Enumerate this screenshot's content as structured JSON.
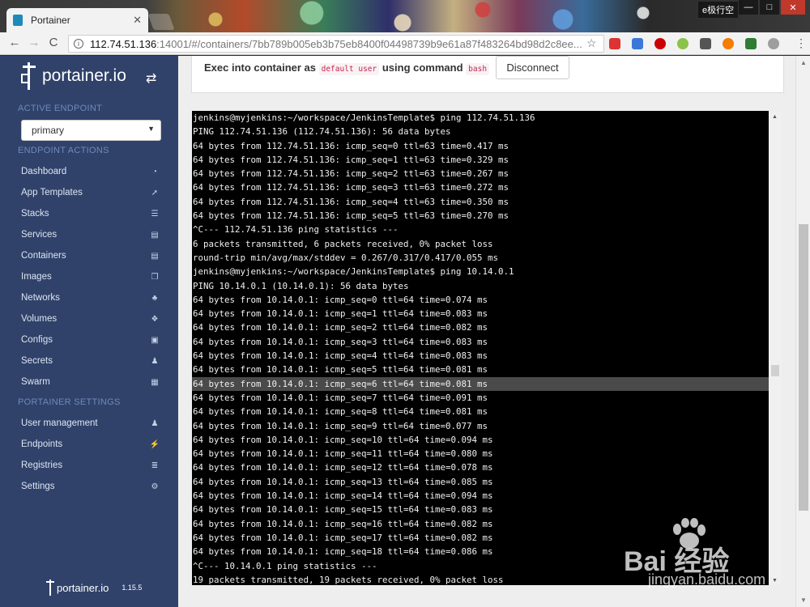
{
  "browser": {
    "tab_title": "Portainer",
    "tab_close": "✕",
    "window_label": "e极行空",
    "url_host": "112.74.51.136",
    "url_path": ":14001/#/containers/7bb789b005eb3b75eb8400f04498739b9e61a87f483264bd98d2c8ee...",
    "nav_back": "←",
    "nav_forward": "→",
    "nav_reload": "C",
    "star": "☆",
    "menu": "⋮",
    "win_min": "—",
    "win_max": "□",
    "win_close": "✕",
    "info_icon": "i"
  },
  "sidebar": {
    "brand": "portainer.io",
    "active_endpoint_header": "ACTIVE ENDPOINT",
    "endpoint_selected": "primary",
    "endpoint_actions_header": "ENDPOINT ACTIONS",
    "endpoint_items": [
      {
        "label": "Dashboard",
        "icon": "tachometer-icon",
        "glyph": "◔"
      },
      {
        "label": "App Templates",
        "icon": "rocket-icon",
        "glyph": "➚"
      },
      {
        "label": "Stacks",
        "icon": "list-icon",
        "glyph": "☰"
      },
      {
        "label": "Services",
        "icon": "server-icon",
        "glyph": "▤"
      },
      {
        "label": "Containers",
        "icon": "server-icon",
        "glyph": "▤"
      },
      {
        "label": "Images",
        "icon": "clone-icon",
        "glyph": "❐"
      },
      {
        "label": "Networks",
        "icon": "sitemap-icon",
        "glyph": "♣"
      },
      {
        "label": "Volumes",
        "icon": "cubes-icon",
        "glyph": "❖"
      },
      {
        "label": "Configs",
        "icon": "file-code-icon",
        "glyph": "▣"
      },
      {
        "label": "Secrets",
        "icon": "user-secret-icon",
        "glyph": "♟"
      },
      {
        "label": "Swarm",
        "icon": "object-group-icon",
        "glyph": "▦"
      }
    ],
    "settings_header": "PORTAINER SETTINGS",
    "settings_items": [
      {
        "label": "User management",
        "icon": "users-icon",
        "glyph": "♟"
      },
      {
        "label": "Endpoints",
        "icon": "plug-icon",
        "glyph": "⚡"
      },
      {
        "label": "Registries",
        "icon": "database-icon",
        "glyph": "≣"
      },
      {
        "label": "Settings",
        "icon": "cogs-icon",
        "glyph": "⚙"
      }
    ],
    "footer_brand": "portainer.io",
    "version": "1.15.5",
    "swap_glyph": "⇄"
  },
  "exec": {
    "prefix": "Exec into container as ",
    "user": "default user",
    "mid": " using command ",
    "command": "bash",
    "disconnect_label": "Disconnect"
  },
  "terminal": {
    "highlighted_line": 19,
    "lines": [
      "jenkins@myjenkins:~/workspace/JenkinsTemplate$ ping 112.74.51.136",
      "PING 112.74.51.136 (112.74.51.136): 56 data bytes",
      "64 bytes from 112.74.51.136: icmp_seq=0 ttl=63 time=0.417 ms",
      "64 bytes from 112.74.51.136: icmp_seq=1 ttl=63 time=0.329 ms",
      "64 bytes from 112.74.51.136: icmp_seq=2 ttl=63 time=0.267 ms",
      "64 bytes from 112.74.51.136: icmp_seq=3 ttl=63 time=0.272 ms",
      "64 bytes from 112.74.51.136: icmp_seq=4 ttl=63 time=0.350 ms",
      "64 bytes from 112.74.51.136: icmp_seq=5 ttl=63 time=0.270 ms",
      "^C--- 112.74.51.136 ping statistics ---",
      "6 packets transmitted, 6 packets received, 0% packet loss",
      "round-trip min/avg/max/stddev = 0.267/0.317/0.417/0.055 ms",
      "jenkins@myjenkins:~/workspace/JenkinsTemplate$ ping 10.14.0.1",
      "PING 10.14.0.1 (10.14.0.1): 56 data bytes",
      "64 bytes from 10.14.0.1: icmp_seq=0 ttl=64 time=0.074 ms",
      "64 bytes from 10.14.0.1: icmp_seq=1 ttl=64 time=0.083 ms",
      "64 bytes from 10.14.0.1: icmp_seq=2 ttl=64 time=0.082 ms",
      "64 bytes from 10.14.0.1: icmp_seq=3 ttl=64 time=0.083 ms",
      "64 bytes from 10.14.0.1: icmp_seq=4 ttl=64 time=0.083 ms",
      "64 bytes from 10.14.0.1: icmp_seq=5 ttl=64 time=0.081 ms",
      "64 bytes from 10.14.0.1: icmp_seq=6 ttl=64 time=0.081 ms",
      "64 bytes from 10.14.0.1: icmp_seq=7 ttl=64 time=0.091 ms",
      "64 bytes from 10.14.0.1: icmp_seq=8 ttl=64 time=0.081 ms",
      "64 bytes from 10.14.0.1: icmp_seq=9 ttl=64 time=0.077 ms",
      "64 bytes from 10.14.0.1: icmp_seq=10 ttl=64 time=0.094 ms",
      "64 bytes from 10.14.0.1: icmp_seq=11 ttl=64 time=0.080 ms",
      "64 bytes from 10.14.0.1: icmp_seq=12 ttl=64 time=0.078 ms",
      "64 bytes from 10.14.0.1: icmp_seq=13 ttl=64 time=0.085 ms",
      "64 bytes from 10.14.0.1: icmp_seq=14 ttl=64 time=0.094 ms",
      "64 bytes from 10.14.0.1: icmp_seq=15 ttl=64 time=0.083 ms",
      "64 bytes from 10.14.0.1: icmp_seq=16 ttl=64 time=0.082 ms",
      "64 bytes from 10.14.0.1: icmp_seq=17 ttl=64 time=0.082 ms",
      "64 bytes from 10.14.0.1: icmp_seq=18 ttl=64 time=0.086 ms",
      "^C--- 10.14.0.1 ping statistics ---",
      "19 packets transmitted, 19 packets received, 0% packet loss"
    ]
  },
  "watermark": {
    "brand": "Bai 经验",
    "site": "jingyan.baidu.com"
  },
  "colors": {
    "sidebar_bg": "#30426a",
    "section_header": "#6f89bb",
    "terminal_bg": "#000000",
    "terminal_fg": "#f0f0f0",
    "code_fg": "#c7254e"
  }
}
